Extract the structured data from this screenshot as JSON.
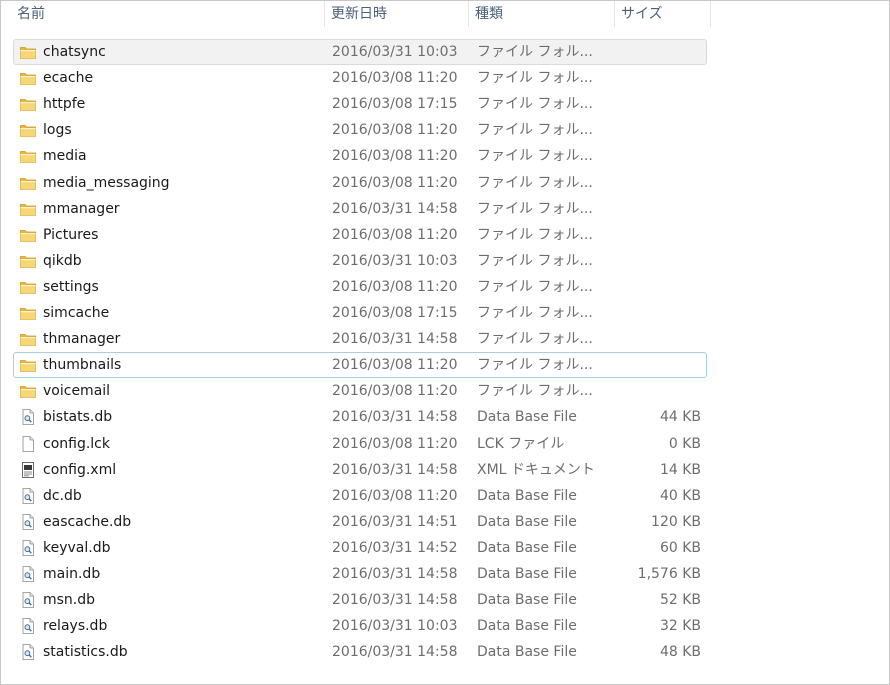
{
  "columns": {
    "name": "名前",
    "date": "更新日時",
    "type": "種類",
    "size": "サイズ"
  },
  "files": [
    {
      "name": "chatsync",
      "date": "2016/03/31 10:03",
      "type": "ファイル フォル...",
      "size": "",
      "icon": "folder-icon",
      "highlight": "grey"
    },
    {
      "name": "ecache",
      "date": "2016/03/08 11:20",
      "type": "ファイル フォル...",
      "size": "",
      "icon": "folder-icon"
    },
    {
      "name": "httpfe",
      "date": "2016/03/08 17:15",
      "type": "ファイル フォル...",
      "size": "",
      "icon": "folder-icon"
    },
    {
      "name": "logs",
      "date": "2016/03/08 11:20",
      "type": "ファイル フォル...",
      "size": "",
      "icon": "folder-icon"
    },
    {
      "name": "media",
      "date": "2016/03/08 11:20",
      "type": "ファイル フォル...",
      "size": "",
      "icon": "folder-icon"
    },
    {
      "name": "media_messaging",
      "date": "2016/03/08 11:20",
      "type": "ファイル フォル...",
      "size": "",
      "icon": "folder-icon"
    },
    {
      "name": "mmanager",
      "date": "2016/03/31 14:58",
      "type": "ファイル フォル...",
      "size": "",
      "icon": "folder-icon"
    },
    {
      "name": "Pictures",
      "date": "2016/03/08 11:20",
      "type": "ファイル フォル...",
      "size": "",
      "icon": "folder-icon"
    },
    {
      "name": "qikdb",
      "date": "2016/03/31 10:03",
      "type": "ファイル フォル...",
      "size": "",
      "icon": "folder-icon"
    },
    {
      "name": "settings",
      "date": "2016/03/08 11:20",
      "type": "ファイル フォル...",
      "size": "",
      "icon": "folder-icon"
    },
    {
      "name": "simcache",
      "date": "2016/03/08 17:15",
      "type": "ファイル フォル...",
      "size": "",
      "icon": "folder-icon"
    },
    {
      "name": "thmanager",
      "date": "2016/03/31 14:58",
      "type": "ファイル フォル...",
      "size": "",
      "icon": "folder-icon"
    },
    {
      "name": "thumbnails",
      "date": "2016/03/08 11:20",
      "type": "ファイル フォル...",
      "size": "",
      "icon": "folder-icon",
      "highlight": "blue"
    },
    {
      "name": "voicemail",
      "date": "2016/03/08 11:20",
      "type": "ファイル フォル...",
      "size": "",
      "icon": "folder-icon"
    },
    {
      "name": "bistats.db",
      "date": "2016/03/31 14:58",
      "type": "Data Base File",
      "size": "44 KB",
      "icon": "database-file-icon"
    },
    {
      "name": "config.lck",
      "date": "2016/03/08 11:20",
      "type": "LCK ファイル",
      "size": "0 KB",
      "icon": "blank-file-icon"
    },
    {
      "name": "config.xml",
      "date": "2016/03/31 14:58",
      "type": "XML ドキュメント",
      "size": "14 KB",
      "icon": "xml-file-icon"
    },
    {
      "name": "dc.db",
      "date": "2016/03/08 11:20",
      "type": "Data Base File",
      "size": "40 KB",
      "icon": "database-file-icon"
    },
    {
      "name": "eascache.db",
      "date": "2016/03/31 14:51",
      "type": "Data Base File",
      "size": "120 KB",
      "icon": "database-file-icon"
    },
    {
      "name": "keyval.db",
      "date": "2016/03/31 14:52",
      "type": "Data Base File",
      "size": "60 KB",
      "icon": "database-file-icon"
    },
    {
      "name": "main.db",
      "date": "2016/03/31 14:58",
      "type": "Data Base File",
      "size": "1,576 KB",
      "icon": "database-file-icon"
    },
    {
      "name": "msn.db",
      "date": "2016/03/31 14:58",
      "type": "Data Base File",
      "size": "52 KB",
      "icon": "database-file-icon"
    },
    {
      "name": "relays.db",
      "date": "2016/03/31 10:03",
      "type": "Data Base File",
      "size": "32 KB",
      "icon": "database-file-icon"
    },
    {
      "name": "statistics.db",
      "date": "2016/03/31 14:58",
      "type": "Data Base File",
      "size": "48 KB",
      "icon": "database-file-icon"
    }
  ]
}
